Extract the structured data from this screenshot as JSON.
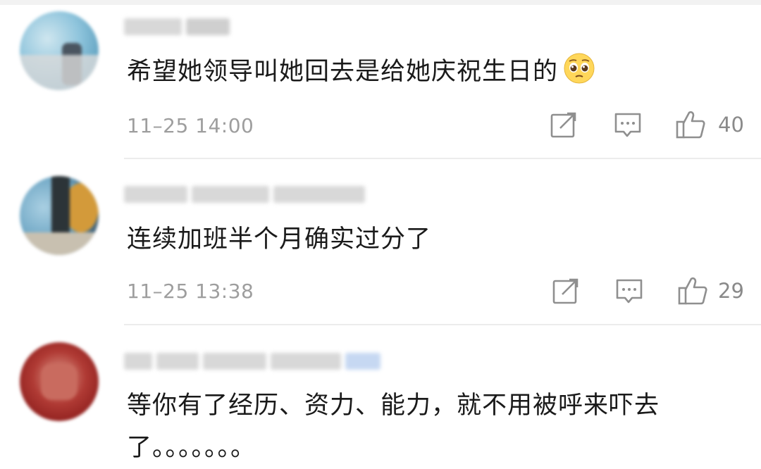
{
  "comments": [
    {
      "text": "希望她领导叫她回去是给她庆祝生日的",
      "emoji": "pleading-face-emoji",
      "time": "11–25 14:00",
      "likes": "40"
    },
    {
      "text": "连续加班半个月确实过分了",
      "time": "11–25 13:38",
      "likes": "29"
    },
    {
      "text_line1": "等你有了经历、资力、能力，就不用被呼来吓去",
      "text_line2": "了。。。。。。。"
    }
  ],
  "icons": {
    "share": "share-edit-icon",
    "reply": "reply-comment-icon",
    "like": "thumbs-up-icon"
  },
  "colors": {
    "text": "#1a1a1a",
    "meta": "#9e9e9e",
    "icon": "#8f8f8f",
    "divider": "#ececec",
    "emoji_face": "#ffd75a"
  }
}
